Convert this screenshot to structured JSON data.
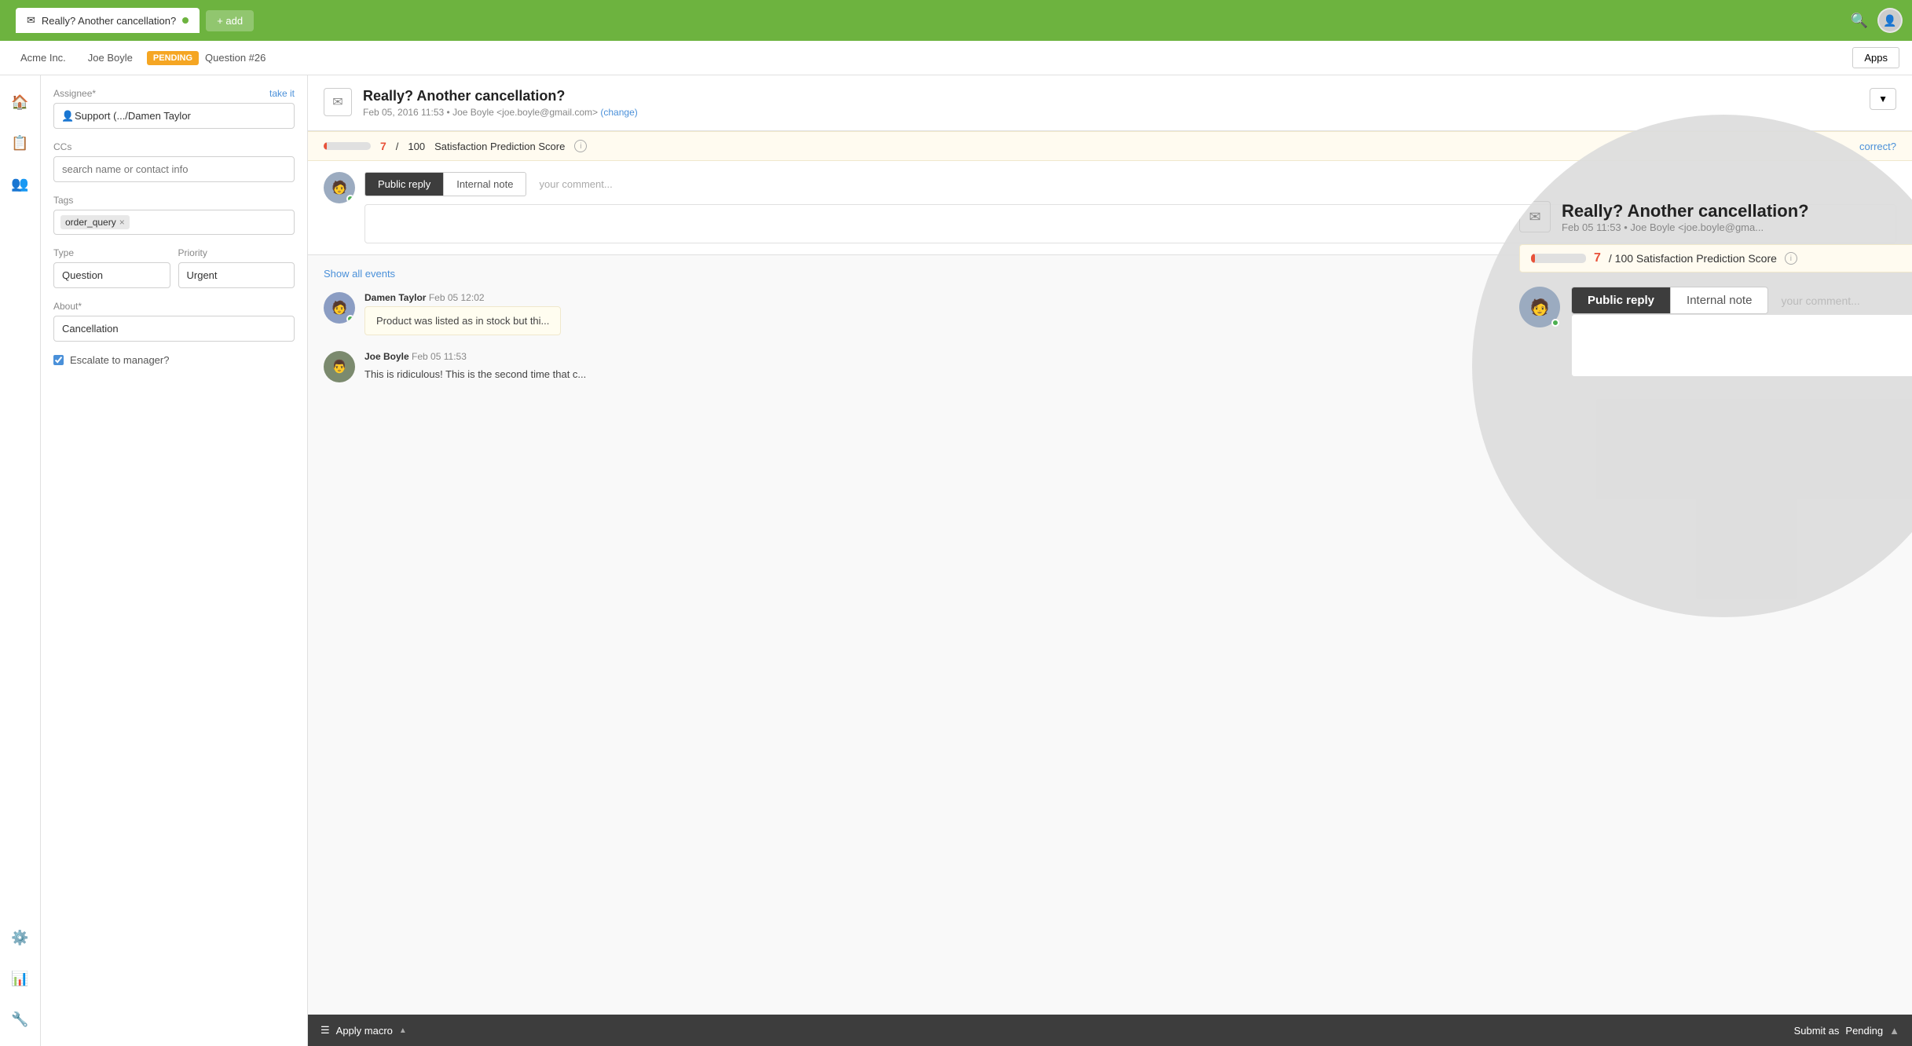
{
  "topbar": {
    "tab_title": "Really? Another cancellation?",
    "tab_dot_color": "#6db33f",
    "add_label": "+ add",
    "search_icon": "🔍",
    "avatar_text": "U"
  },
  "subheader": {
    "breadcrumb1": "Acme Inc.",
    "breadcrumb2": "Joe Boyle",
    "pending_label": "PENDING",
    "question_label": "Question #26",
    "apps_label": "Apps"
  },
  "sidebar": {
    "assignee_label": "Assignee*",
    "take_it_label": "take it",
    "assignee_value": "Support (.../Damen Taylor",
    "ccs_label": "CCs",
    "ccs_placeholder": "search name or contact info",
    "tags_label": "Tags",
    "tag1": "order_query",
    "type_label": "Type",
    "type_value": "Question",
    "priority_label": "Priority",
    "priority_value": "Urgent",
    "about_label": "About*",
    "about_value": "Cancellation",
    "escalate_label": "Escalate to manager?",
    "escalate_checked": true
  },
  "ticket": {
    "title": "Really? Another cancellation?",
    "date": "Feb 05, 2016 11:53",
    "author": "Joe Boyle <joe.boyle@gmail.com>",
    "change_link": "(change)",
    "dropdown_label": "▼"
  },
  "satisfaction": {
    "score": "7",
    "total": "100",
    "label": "Satisfaction Prediction Score",
    "bar_width_pct": 7,
    "correct_label": "correct?"
  },
  "reply": {
    "public_reply_label": "Public reply",
    "internal_note_label": "Internal note",
    "comment_placeholder": "your comment..."
  },
  "events": {
    "show_all_label": "Show all events",
    "messages": [
      {
        "id": "msg1",
        "sender": "Damen Taylor",
        "date": "Feb 05 12:02",
        "content": "Product was listed as in stock but thi...",
        "type": "note",
        "avatar_color": "#8B9DC3"
      },
      {
        "id": "msg2",
        "sender": "Joe Boyle",
        "date": "Feb 05 11:53",
        "content": "This is ridiculous! This is the second time that c...",
        "type": "plain",
        "avatar_color": "#7B8A6E"
      }
    ]
  },
  "bottombar": {
    "apply_macro_label": "Apply macro",
    "submit_label": "Submit as",
    "pending_status": "Pending"
  },
  "zoom": {
    "title": "Really? Another cancellation?",
    "meta": "Feb 05 11:53  •  Joe Boyle <joe.boyle@gma...",
    "score": "7",
    "score_label": "/ 100 Satisfaction Prediction Score",
    "public_reply_label": "Public reply",
    "internal_note_label": "Internal note",
    "comment_placeholder": "your comment..."
  }
}
